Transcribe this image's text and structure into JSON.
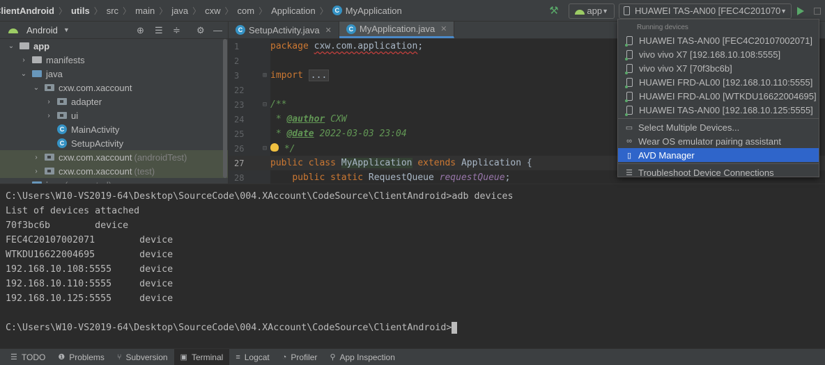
{
  "breadcrumbs": [
    "ClientAndroid",
    "utils",
    "src",
    "main",
    "java",
    "cxw",
    "com",
    "Application",
    "MyApplication"
  ],
  "toolbar": {
    "run_config": "app",
    "selected_device": "HUAWEI TAS-AN00 [FEC4C201070..."
  },
  "project_panel": {
    "view_label": "Android",
    "tree": [
      {
        "label": "app",
        "indent": 0,
        "arrow": "open",
        "icon": "folder",
        "bold": true
      },
      {
        "label": "manifests",
        "indent": 1,
        "arrow": "closed",
        "icon": "folder"
      },
      {
        "label": "java",
        "indent": 1,
        "arrow": "open",
        "icon": "folder"
      },
      {
        "label": "cxw.com.xaccount",
        "indent": 2,
        "arrow": "open",
        "icon": "package"
      },
      {
        "label": "adapter",
        "indent": 3,
        "arrow": "closed",
        "icon": "package"
      },
      {
        "label": "ui",
        "indent": 3,
        "arrow": "closed",
        "icon": "package"
      },
      {
        "label": "MainActivity",
        "indent": 3,
        "arrow": "none",
        "icon": "class"
      },
      {
        "label": "SetupActivity",
        "indent": 3,
        "arrow": "none",
        "icon": "class"
      },
      {
        "label": "cxw.com.xaccount",
        "suffix": "(androidTest)",
        "indent": 2,
        "arrow": "closed",
        "icon": "package",
        "highlight": true
      },
      {
        "label": "cxw.com.xaccount",
        "suffix": "(test)",
        "indent": 2,
        "arrow": "closed",
        "icon": "package",
        "highlight": true
      },
      {
        "label": "java",
        "suffix": "(generated)",
        "indent": 1,
        "arrow": "closed",
        "icon": "folder"
      }
    ]
  },
  "editor": {
    "tabs": [
      {
        "label": "SetupActivity.java",
        "active": false
      },
      {
        "label": "MyApplication.java",
        "active": true
      }
    ],
    "line_numbers": [
      "1",
      "2",
      "3",
      "22",
      "23",
      "24",
      "25",
      "26",
      "27",
      "28"
    ],
    "code": {
      "package_kw": "package",
      "package_name": "cxw.com.application",
      "package_end": ";",
      "import_kw": "import",
      "import_folded": "...",
      "doc_open": "/**",
      "doc_star1": " * ",
      "author_tag": "@author",
      "author_value": " CXW",
      "doc_star2": " * ",
      "date_tag": "@date",
      "date_value": " 2022-03-03 23:04",
      "doc_close": " */",
      "decl_kw": "public class",
      "class_name": "MyApplication",
      "extends_kw": "extends",
      "super_name": "Application",
      "decl_end": " {",
      "field_indent": "    ",
      "field_kw": "public static",
      "field_type": " RequestQueue ",
      "field_name": "requestQueue",
      "field_end": ";"
    }
  },
  "device_dropdown": {
    "section_title": "Running devices",
    "devices": [
      "HUAWEI TAS-AN00 [FEC4C20107002071]",
      "vivo vivo X7 [192.168.10.108:5555]",
      "vivo vivo X7 [70f3bc6b]",
      "HUAWEI FRD-AL00 [192.168.10.110:5555]",
      "HUAWEI FRD-AL00 [WTKDU16622004695]",
      "HUAWEI TAS-AN00 [192.168.10.125:5555]"
    ],
    "actions": [
      {
        "label": "Select Multiple Devices...",
        "icon": "select-multiple-icon",
        "selected": false
      },
      {
        "label": "Wear OS emulator pairing assistant",
        "icon": "link-icon",
        "selected": false
      },
      {
        "label": "AVD Manager",
        "icon": "avd-manager-icon",
        "selected": true
      }
    ],
    "footer_action": {
      "label": "Troubleshoot Device Connections",
      "icon": "list-icon"
    }
  },
  "terminal": {
    "lines": [
      "C:\\Users\\W10-VS2019-64\\Desktop\\SourceCode\\004.XAccount\\CodeSource\\ClientAndroid>adb devices",
      "List of devices attached",
      "70f3bc6b        device",
      "FEC4C20107002071        device",
      "WTKDU16622004695        device",
      "192.168.10.108:5555     device",
      "192.168.10.110:5555     device",
      "192.168.10.125:5555     device",
      "",
      "C:\\Users\\W10-VS2019-64\\Desktop\\SourceCode\\004.XAccount\\CodeSource\\ClientAndroid>"
    ]
  },
  "bottom_tabs": [
    {
      "label": "TODO",
      "icon": "todo-icon",
      "active": false
    },
    {
      "label": "Problems",
      "icon": "problems-icon",
      "active": false
    },
    {
      "label": "Subversion",
      "icon": "subversion-icon",
      "active": false
    },
    {
      "label": "Terminal",
      "icon": "terminal-icon",
      "active": true
    },
    {
      "label": "Logcat",
      "icon": "logcat-icon",
      "active": false
    },
    {
      "label": "Profiler",
      "icon": "profiler-icon",
      "active": false
    },
    {
      "label": "App Inspection",
      "icon": "app-inspection-icon",
      "active": false
    }
  ]
}
